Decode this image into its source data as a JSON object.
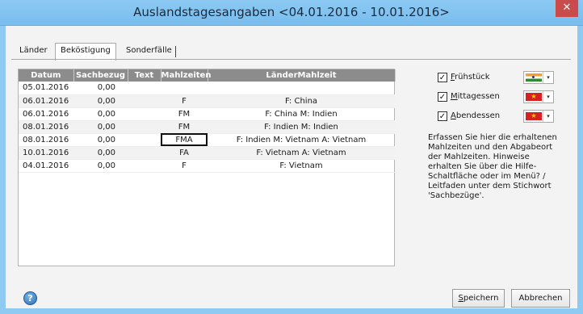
{
  "window": {
    "title": "Auslandstagesangaben <04.01.2016  -  10.01.2016>",
    "close_glyph": "✕"
  },
  "tabs": [
    {
      "label": "Länder",
      "active": false
    },
    {
      "label": "Beköstigung",
      "active": true
    },
    {
      "label": "Sonderfälle",
      "active": false
    }
  ],
  "table": {
    "columns": [
      "Datum",
      "Sachbezug",
      "Text",
      "Mahlzeiten",
      "LänderMahlzeit"
    ],
    "rows": [
      {
        "datum": "05.01.2016",
        "sachbezug": "0,00",
        "text": "",
        "mahlzeiten": "",
        "laender": ""
      },
      {
        "datum": "06.01.2016",
        "sachbezug": "0,00",
        "text": "",
        "mahlzeiten": "F",
        "laender": "F: China"
      },
      {
        "datum": "06.01.2016",
        "sachbezug": "0,00",
        "text": "",
        "mahlzeiten": "FM",
        "laender": "F: China M: Indien"
      },
      {
        "datum": "08.01.2016",
        "sachbezug": "0,00",
        "text": "",
        "mahlzeiten": "FM",
        "laender": "F: Indien M: Indien"
      },
      {
        "datum": "08.01.2016",
        "sachbezug": "0,00",
        "text": "",
        "mahlzeiten": "FMA",
        "laender": "F: Indien M: Vietnam A: Vietnam"
      },
      {
        "datum": "10.01.2016",
        "sachbezug": "0,00",
        "text": "",
        "mahlzeiten": "FA",
        "laender": "F: Vietnam A: Vietnam"
      },
      {
        "datum": "04.01.2016",
        "sachbezug": "0,00",
        "text": "",
        "mahlzeiten": "F",
        "laender": "F: Vietnam"
      }
    ]
  },
  "meals": [
    {
      "accel": "F",
      "rest": "rühstück",
      "checked": true,
      "flag": "india"
    },
    {
      "accel": "M",
      "rest": "ittagessen",
      "checked": true,
      "flag": "vietnam"
    },
    {
      "accel": "A",
      "rest": "bendessen",
      "checked": true,
      "flag": "vietnam"
    }
  ],
  "info_text": "Erfassen Sie hier die erhaltenen Mahlzeiten und den Abgabeort der Mahlzeiten. Hinweise erhalten Sie über die Hilfe-Schaltfläche oder im Menü? / Leitfaden unter dem Stichwort 'Sachbezüge'.",
  "buttons": {
    "save_accel": "S",
    "save_rest": "peichern",
    "cancel": "Abbrechen",
    "help_glyph": "?"
  },
  "glyphs": {
    "check": "✓",
    "dropdown": "▾",
    "star": "★"
  }
}
